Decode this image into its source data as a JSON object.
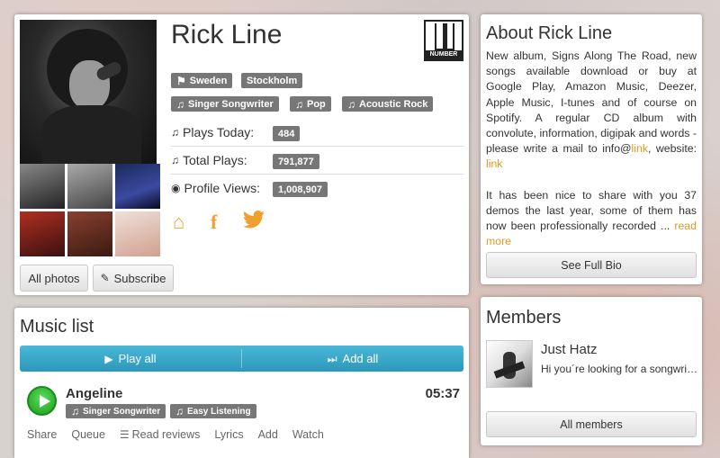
{
  "profile": {
    "artist_name": "Rick Line",
    "logo_text": "NUMBER",
    "location_tags": [
      "Sweden",
      "Stockholm"
    ],
    "genre_tags": [
      "Singer Songwriter",
      "Pop",
      "Acoustic Rock"
    ],
    "stats": {
      "plays_today_label": "Plays Today:",
      "plays_today": "484",
      "total_plays_label": "Total Plays:",
      "total_plays": "791,877",
      "profile_views_label": "Profile Views:",
      "profile_views": "1,008,907"
    },
    "all_photos_label": "All photos",
    "subscribe_label": "Subscribe",
    "social_icons": [
      "home-icon",
      "facebook-icon",
      "twitter-icon"
    ]
  },
  "about": {
    "title": "About Rick Line",
    "text_p1": "New album, Signs Along The Road, new songs available download or buy at Google Play, Amazon Music, Deezer, Apple Music, I-tunes and of course on Spotify. A regular CD album with convolute, information, digipak and words - please write a mail to info@",
    "link1": "link",
    "mid": ", website: ",
    "link2": "link",
    "text_p2": "It has been nice to share with you 37 demos the last year, some of them has now been professionally recorded ... ",
    "read_more": "read more",
    "full_bio_label": "See Full Bio"
  },
  "music": {
    "title": "Music list",
    "play_all": "Play all",
    "add_all": "Add all",
    "song": {
      "title": "Angeline",
      "duration": "05:37",
      "tags": [
        "Singer Songwriter",
        "Easy Listening"
      ]
    },
    "actions": [
      "Share",
      "Queue",
      "Read reviews",
      "Lyrics",
      "Add",
      "Watch"
    ]
  },
  "members": {
    "title": "Members",
    "name": "Just Hatz",
    "desc": "Hi you´re looking for a songwriter...",
    "all_members_label": "All members"
  },
  "colors": {
    "accent_orange": "#f0a030",
    "play_bar_blue": "#2c97bb",
    "tag_gray": "#777777",
    "play_green": "#1a9a1a"
  }
}
